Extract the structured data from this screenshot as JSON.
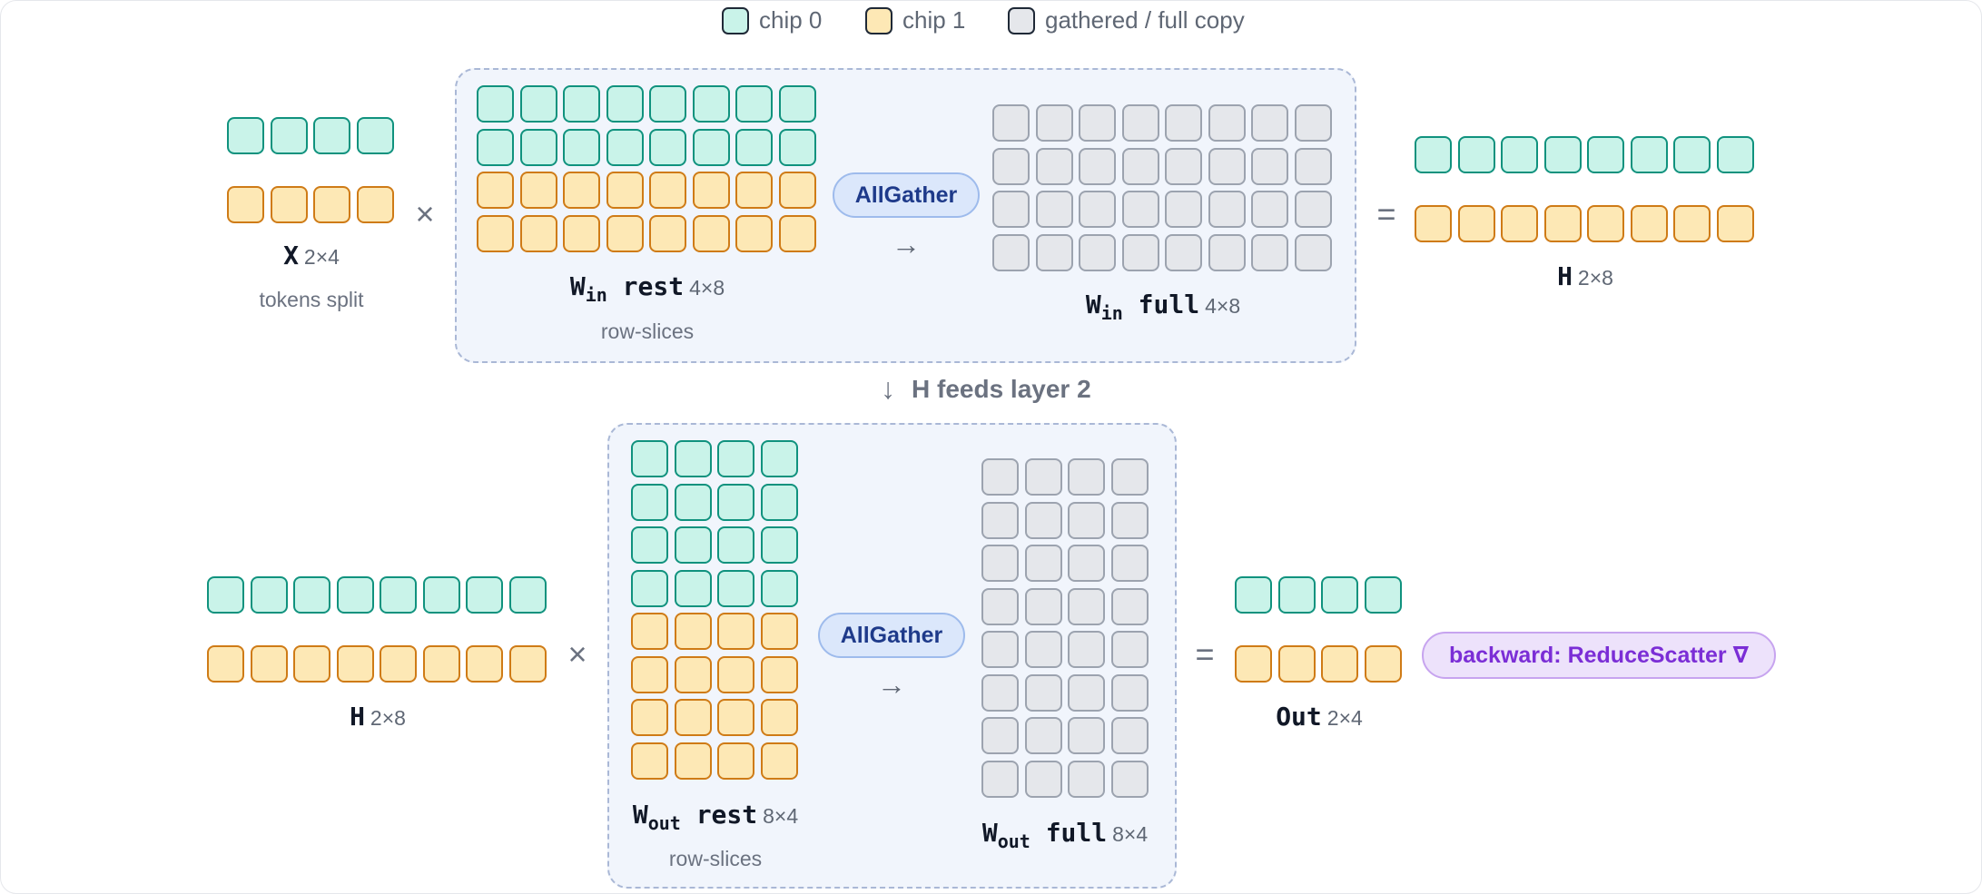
{
  "colors": {
    "chip0_fill": "#c9f3e9",
    "chip0_border": "#10927e",
    "chip1_fill": "#fde8b5",
    "chip1_border": "#cf7b16",
    "gathered_fill": "#e5e7eb",
    "gathered_border": "#9ca3af",
    "panel_fill": "#f1f5fc",
    "panel_border": "#aab8d6",
    "allgather_fill": "#dbe7fb",
    "allgather_text": "#1e3a8a",
    "backward_fill": "#ede2fb",
    "backward_text": "#7b2ed6"
  },
  "legend": [
    {
      "label": "chip 0",
      "kind": "chip0"
    },
    {
      "label": "chip 1",
      "kind": "chip1"
    },
    {
      "label": "gathered / full copy",
      "kind": "gathered"
    }
  ],
  "layer1": {
    "x": {
      "name": "X",
      "dim": "2×4",
      "caption": "tokens split"
    },
    "times": "×",
    "w_rest": {
      "name": "W",
      "sub": "in",
      "suffix": "rest",
      "dim": "4×8",
      "caption": "row-slices"
    },
    "collective": "AllGather",
    "arrow": "→",
    "w_full": {
      "name": "W",
      "sub": "in",
      "suffix": "full",
      "dim": "4×8"
    },
    "equals": "=",
    "h": {
      "name": "H",
      "dim": "2×8"
    }
  },
  "feeds": {
    "glyph": "↓",
    "text": "H feeds layer 2"
  },
  "layer2": {
    "h": {
      "name": "H",
      "dim": "2×8"
    },
    "times": "×",
    "w_rest": {
      "name": "W",
      "sub": "out",
      "suffix": "rest",
      "dim": "8×4",
      "caption": "row-slices"
    },
    "collective": "AllGather",
    "arrow": "→",
    "w_full": {
      "name": "W",
      "sub": "out",
      "suffix": "full",
      "dim": "8×4"
    },
    "equals": "=",
    "out": {
      "name": "Out",
      "dim": "2×4"
    },
    "backward": "backward: ReduceScatter ∇"
  }
}
